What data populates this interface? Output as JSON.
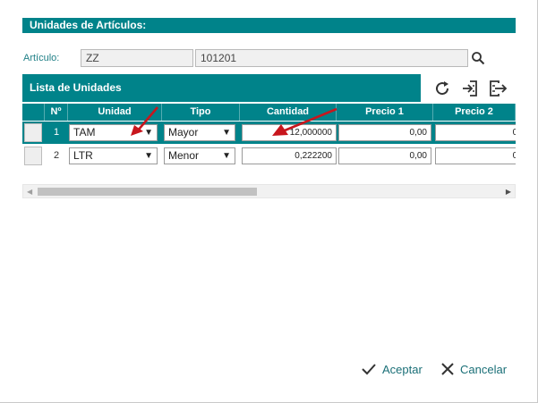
{
  "dialog": {
    "title": "Unidades de Artículos:"
  },
  "article": {
    "label": "Artículo:",
    "code": "ZZ",
    "number": "101201"
  },
  "list": {
    "title": "Lista de Unidades"
  },
  "grid": {
    "columns": [
      "Nº",
      "Unidad",
      "Tipo",
      "Cantidad",
      "Precio 1",
      "Precio 2"
    ],
    "rows": [
      {
        "num": "1",
        "unidad": "TAM",
        "tipo": "Mayor",
        "cantidad": "12,000000",
        "precio1": "0,00",
        "precio2": "0,"
      },
      {
        "num": "2",
        "unidad": "LTR",
        "tipo": "Menor",
        "cantidad": "0,222200",
        "precio1": "0,00",
        "precio2": "0,"
      }
    ]
  },
  "icons": {
    "search": "search-icon",
    "refresh": "refresh-icon",
    "import": "import-icon",
    "export": "export-icon",
    "accept": "check-icon",
    "cancel": "close-icon"
  },
  "footer": {
    "accept_label": "Aceptar",
    "cancel_label": "Cancelar"
  },
  "colors": {
    "accent": "#00838a",
    "annotation": "#c8161d"
  }
}
